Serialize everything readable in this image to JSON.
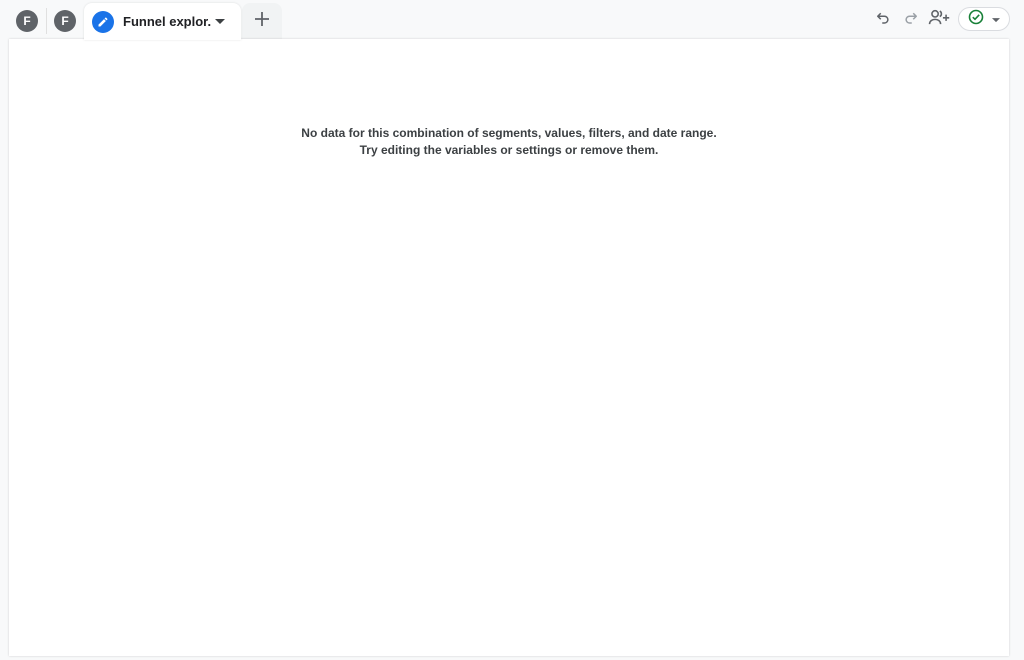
{
  "tabs": {
    "avatars": [
      {
        "letter": "F"
      },
      {
        "letter": "F"
      }
    ],
    "active": {
      "label": "Funnel explor...",
      "icon": "pencil-icon"
    },
    "add_icon": "plus-icon"
  },
  "toolbar": {
    "undo_icon": "undo-icon",
    "redo_icon": "redo-icon",
    "share_icon": "share-users-icon",
    "status_icon": "check-circle-icon"
  },
  "colors": {
    "accent": "#1a73e8",
    "avatar_bg": "#5f6368",
    "status_green": "#188038"
  },
  "empty_state": {
    "line1": "No data for this combination of segments, values, filters, and date range.",
    "line2": "Try editing the variables or settings or remove them."
  }
}
